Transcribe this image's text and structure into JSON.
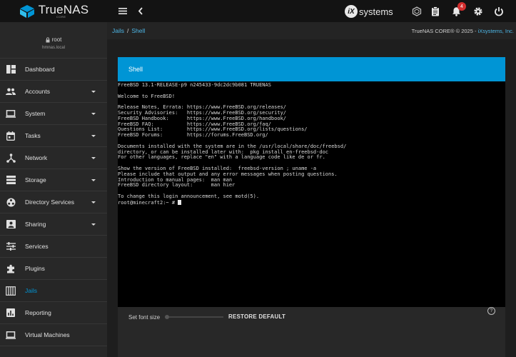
{
  "brand": {
    "name": "TrueNAS",
    "sub": "CORE"
  },
  "topbar": {
    "vendor": "systems",
    "vendor_mark": "iX",
    "notification_count": "4"
  },
  "user": {
    "name": "root",
    "host": "hmnas.local"
  },
  "nav": [
    {
      "label": "Dashboard",
      "icon": "dashboard-icon",
      "caret": false
    },
    {
      "label": "Accounts",
      "icon": "accounts-icon",
      "caret": true
    },
    {
      "label": "System",
      "icon": "system-icon",
      "caret": true
    },
    {
      "label": "Tasks",
      "icon": "tasks-icon",
      "caret": true
    },
    {
      "label": "Network",
      "icon": "network-icon",
      "caret": true
    },
    {
      "label": "Storage",
      "icon": "storage-icon",
      "caret": true
    },
    {
      "label": "Directory Services",
      "icon": "directory-services-icon",
      "caret": true
    },
    {
      "label": "Sharing",
      "icon": "sharing-icon",
      "caret": true
    },
    {
      "label": "Services",
      "icon": "services-icon",
      "caret": false
    },
    {
      "label": "Plugins",
      "icon": "plugins-icon",
      "caret": false
    },
    {
      "label": "Jails",
      "icon": "jails-icon",
      "caret": false,
      "active": true
    },
    {
      "label": "Reporting",
      "icon": "reporting-icon",
      "caret": false
    },
    {
      "label": "Virtual Machines",
      "icon": "virtual-machines-icon",
      "caret": false
    }
  ],
  "breadcrumb": {
    "parent": "Jails",
    "separator": "/",
    "current": "Shell"
  },
  "copyright": {
    "text": "TrueNAS CORE® © 2025 - ",
    "company": "iXsystems, Inc."
  },
  "card": {
    "title": "Shell"
  },
  "terminal": {
    "lines": [
      "FreeBSD 13.1-RELEASE-p9 n245433-9dc2dc9b081 TRUENAS",
      "",
      "Welcome to FreeBSD!",
      "",
      "Release Notes, Errata: https://www.FreeBSD.org/releases/",
      "Security Advisories:   https://www.FreeBSD.org/security/",
      "FreeBSD Handbook:      https://www.FreeBSD.org/handbook/",
      "FreeBSD FAQ:           https://www.FreeBSD.org/faq/",
      "Questions List:        https://www.FreeBSD.org/lists/questions/",
      "FreeBSD Forums:        https://forums.FreeBSD.org/",
      "",
      "Documents installed with the system are in the /usr/local/share/doc/freebsd/",
      "directory, or can be installed later with:  pkg install en-freebsd-doc",
      "For other languages, replace \"en\" with a language code like de or fr.",
      "",
      "Show the version of FreeBSD installed:  freebsd-version ; uname -a",
      "Please include that output and any error messages when posting questions.",
      "Introduction to manual pages:  man man",
      "FreeBSD directory layout:      man hier",
      "",
      "To change this login announcement, see motd(5).",
      "root@minecraft2:~ # "
    ]
  },
  "footer": {
    "font_size_label": "Set font size",
    "restore_label": "RESTORE DEFAULT",
    "help_symbol": "?"
  },
  "colors": {
    "accent": "#0095d5",
    "sidebar": "#282828",
    "topbar": "#131313",
    "badge": "#d32f2f"
  }
}
